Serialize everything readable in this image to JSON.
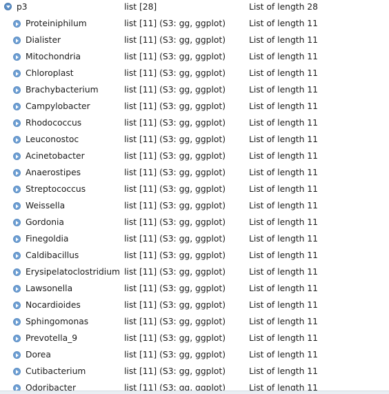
{
  "parent": {
    "name": "p3",
    "type": "list [28]",
    "value": "List of length 28"
  },
  "items": [
    {
      "name": "Proteiniphilum",
      "type": "list [11] (S3: gg, ggplot)",
      "value": "List of length 11"
    },
    {
      "name": "Dialister",
      "type": "list [11] (S3: gg, ggplot)",
      "value": "List of length 11"
    },
    {
      "name": "Mitochondria",
      "type": "list [11] (S3: gg, ggplot)",
      "value": "List of length 11"
    },
    {
      "name": "Chloroplast",
      "type": "list [11] (S3: gg, ggplot)",
      "value": "List of length 11"
    },
    {
      "name": "Brachybacterium",
      "type": "list [11] (S3: gg, ggplot)",
      "value": "List of length 11"
    },
    {
      "name": "Campylobacter",
      "type": "list [11] (S3: gg, ggplot)",
      "value": "List of length 11"
    },
    {
      "name": "Rhodococcus",
      "type": "list [11] (S3: gg, ggplot)",
      "value": "List of length 11"
    },
    {
      "name": "Leuconostoc",
      "type": "list [11] (S3: gg, ggplot)",
      "value": "List of length 11"
    },
    {
      "name": "Acinetobacter",
      "type": "list [11] (S3: gg, ggplot)",
      "value": "List of length 11"
    },
    {
      "name": "Anaerostipes",
      "type": "list [11] (S3: gg, ggplot)",
      "value": "List of length 11"
    },
    {
      "name": "Streptococcus",
      "type": "list [11] (S3: gg, ggplot)",
      "value": "List of length 11"
    },
    {
      "name": "Weissella",
      "type": "list [11] (S3: gg, ggplot)",
      "value": "List of length 11"
    },
    {
      "name": "Gordonia",
      "type": "list [11] (S3: gg, ggplot)",
      "value": "List of length 11"
    },
    {
      "name": "Finegoldia",
      "type": "list [11] (S3: gg, ggplot)",
      "value": "List of length 11"
    },
    {
      "name": "Caldibacillus",
      "type": "list [11] (S3: gg, ggplot)",
      "value": "List of length 11"
    },
    {
      "name": "Erysipelatoclostridium",
      "type": "list [11] (S3: gg, ggplot)",
      "value": "List of length 11"
    },
    {
      "name": "Lawsonella",
      "type": "list [11] (S3: gg, ggplot)",
      "value": "List of length 11"
    },
    {
      "name": "Nocardioides",
      "type": "list [11] (S3: gg, ggplot)",
      "value": "List of length 11"
    },
    {
      "name": "Sphingomonas",
      "type": "list [11] (S3: gg, ggplot)",
      "value": "List of length 11"
    },
    {
      "name": "Prevotella_9",
      "type": "list [11] (S3: gg, ggplot)",
      "value": "List of length 11"
    },
    {
      "name": "Dorea",
      "type": "list [11] (S3: gg, ggplot)",
      "value": "List of length 11"
    },
    {
      "name": "Cutibacterium",
      "type": "list [11] (S3: gg, ggplot)",
      "value": "List of length 11"
    },
    {
      "name": "Odoribacter",
      "type": "list [11] (S3: gg, ggplot)",
      "value": "List of length 11"
    }
  ],
  "icons": {
    "collapse": "collapse-arrow-icon",
    "expand": "expand-arrow-icon"
  },
  "colors": {
    "icon_blue": "#5b8fc7"
  }
}
